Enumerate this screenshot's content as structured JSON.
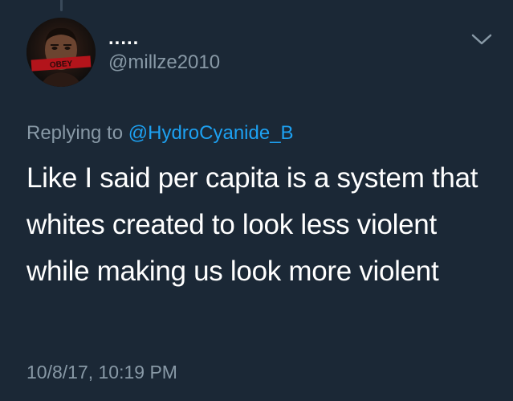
{
  "tweet": {
    "display_name": ".....",
    "handle": "@millze2010",
    "reply_prefix": "Replying to ",
    "reply_to_handle": "@HydroCyanide_B",
    "text": "Like I said per capita is a system that whites created to look less violent while making us look more violent",
    "timestamp": "10/8/17, 10:19 PM",
    "avatar_overlay_text": "OBEY"
  },
  "icons": {
    "menu": "chevron-down-icon",
    "avatar": "profile-photo"
  },
  "colors": {
    "background": "#1b2836",
    "primary_text": "#ffffff",
    "secondary_text": "#8899a6",
    "link": "#1da1f2"
  }
}
